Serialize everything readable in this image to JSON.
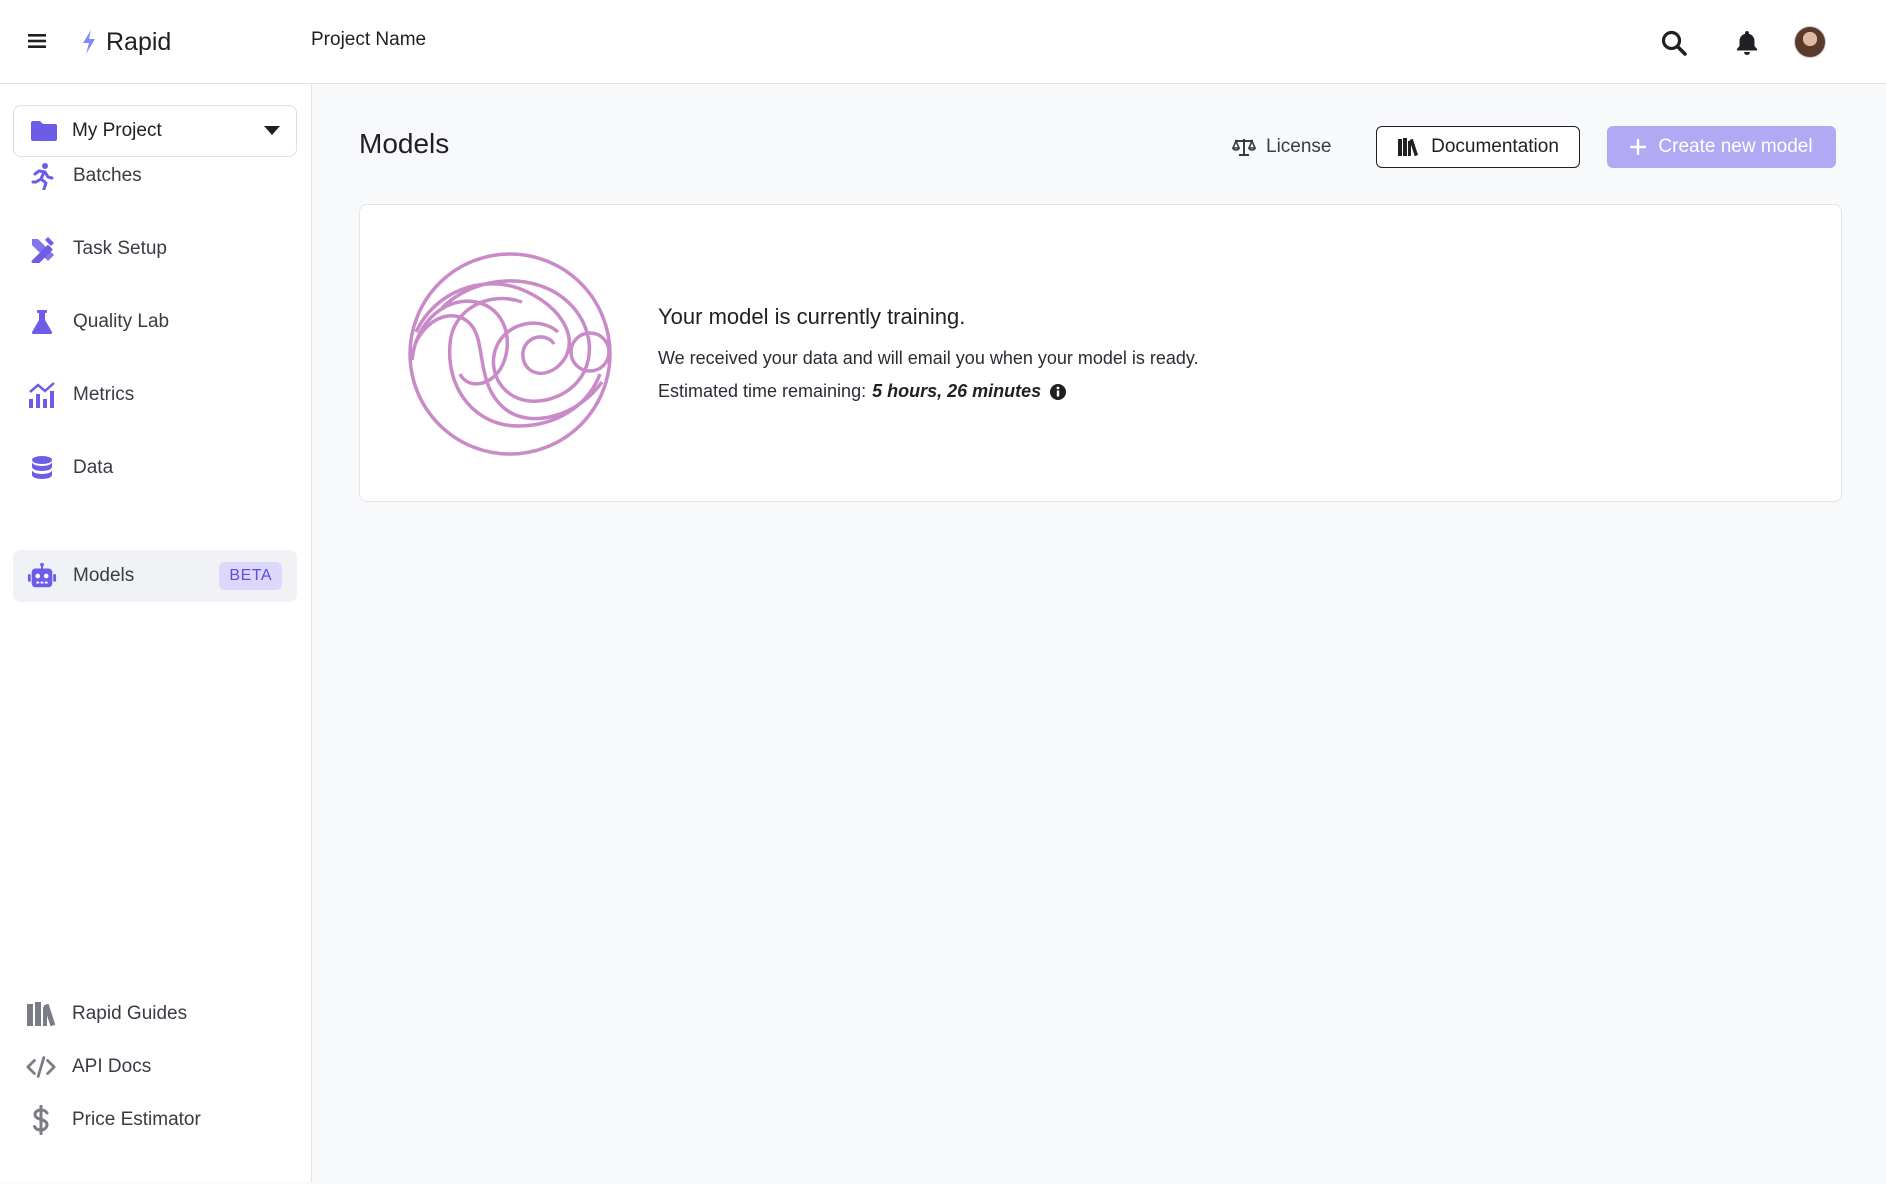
{
  "topbar": {
    "brand": "Rapid",
    "project_name": "Project Name"
  },
  "sidebar": {
    "project_select": "My Project",
    "nav": [
      {
        "label": "Batches",
        "icon": "running-person-icon"
      },
      {
        "label": "Task Setup",
        "icon": "pencil-ruler-icon"
      },
      {
        "label": "Quality Lab",
        "icon": "flask-icon"
      },
      {
        "label": "Metrics",
        "icon": "chart-icon"
      },
      {
        "label": "Data",
        "icon": "database-icon"
      },
      {
        "label": "Models",
        "icon": "robot-icon",
        "badge": "BETA",
        "active": true
      }
    ],
    "guides": [
      {
        "label": "Rapid Guides",
        "icon": "books-icon"
      },
      {
        "label": "API Docs",
        "icon": "code-icon"
      },
      {
        "label": "Price Estimator",
        "icon": "dollar-icon"
      }
    ]
  },
  "main": {
    "title": "Models",
    "license_label": "License",
    "documentation_label": "Documentation",
    "create_label": "Create new model",
    "card": {
      "title": "Your model is currently training.",
      "line1": "We received your data and will email you when your model is ready.",
      "line2_prefix": "Estimated time remaining:",
      "eta": "5 hours, 26 minutes"
    }
  },
  "colors": {
    "accent": "#6c5ce7",
    "accent_light": "#b1a9f4",
    "badge_bg": "#dcd7fb",
    "logo": "#c98ac7"
  }
}
